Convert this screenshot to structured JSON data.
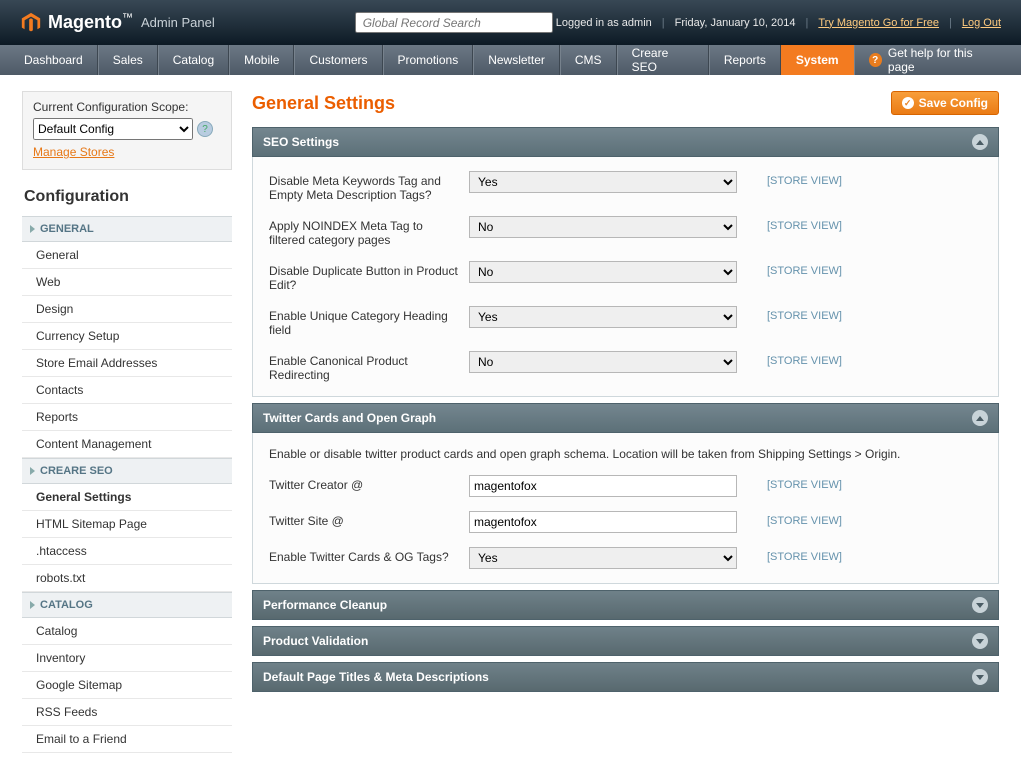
{
  "header": {
    "brand": "Magento",
    "brand_suffix": "Admin Panel",
    "search_placeholder": "Global Record Search",
    "logged_in": "Logged in as admin",
    "date": "Friday, January 10, 2014",
    "try_link": "Try Magento Go for Free",
    "logout": "Log Out"
  },
  "nav": {
    "items": [
      "Dashboard",
      "Sales",
      "Catalog",
      "Mobile",
      "Customers",
      "Promotions",
      "Newsletter",
      "CMS",
      "Creare SEO",
      "Reports",
      "System"
    ],
    "active": "System",
    "help": "Get help for this page"
  },
  "scope": {
    "label": "Current Configuration Scope:",
    "value": "Default Config",
    "manage": "Manage Stores"
  },
  "sidebar": {
    "title": "Configuration",
    "sections": [
      {
        "heading": "GENERAL",
        "items": [
          "General",
          "Web",
          "Design",
          "Currency Setup",
          "Store Email Addresses",
          "Contacts",
          "Reports",
          "Content Management"
        ]
      },
      {
        "heading": "CREARE SEO",
        "items": [
          "General Settings",
          "HTML Sitemap Page",
          ".htaccess",
          "robots.txt"
        ],
        "active": "General Settings"
      },
      {
        "heading": "CATALOG",
        "items": [
          "Catalog",
          "Inventory",
          "Google Sitemap",
          "RSS Feeds",
          "Email to a Friend"
        ]
      }
    ]
  },
  "page": {
    "title": "General Settings",
    "save": "Save Config"
  },
  "scope_label": "[STORE VIEW]",
  "fieldsets": [
    {
      "title": "SEO Settings",
      "open": true,
      "rows": [
        {
          "label": "Disable Meta Keywords Tag and Empty Meta Description Tags?",
          "type": "select",
          "value": "Yes"
        },
        {
          "label": "Apply NOINDEX Meta Tag to filtered category pages",
          "type": "select",
          "value": "No"
        },
        {
          "label": "Disable Duplicate Button in Product Edit?",
          "type": "select",
          "value": "No"
        },
        {
          "label": "Enable Unique Category Heading field",
          "type": "select",
          "value": "Yes"
        },
        {
          "label": "Enable Canonical Product Redirecting",
          "type": "select",
          "value": "No"
        }
      ]
    },
    {
      "title": "Twitter Cards and Open Graph",
      "open": true,
      "note": "Enable or disable twitter product cards and open graph schema. Location will be taken from Shipping Settings > Origin.",
      "rows": [
        {
          "label": "Twitter Creator @",
          "type": "text",
          "value": "magentofox"
        },
        {
          "label": "Twitter Site @",
          "type": "text",
          "value": "magentofox"
        },
        {
          "label": "Enable Twitter Cards & OG Tags?",
          "type": "select",
          "value": "Yes"
        }
      ]
    },
    {
      "title": "Performance Cleanup",
      "open": false
    },
    {
      "title": "Product Validation",
      "open": false
    },
    {
      "title": "Default Page Titles & Meta Descriptions",
      "open": false
    }
  ]
}
